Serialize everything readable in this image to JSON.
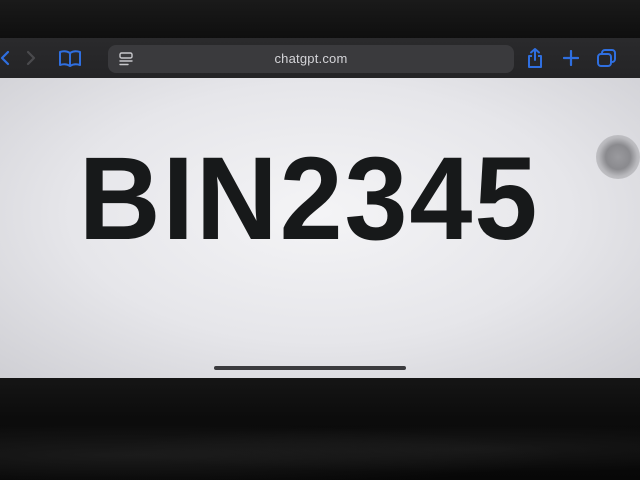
{
  "browser": {
    "url": "chatgpt.com",
    "icons": {
      "back": "chevron-left-icon",
      "forward": "chevron-right-icon",
      "bookmarks": "book-icon",
      "page_menu": "page-menu-icon",
      "reload": "reload-icon",
      "share": "share-icon",
      "new_tab": "plus-icon",
      "tabs": "tabs-icon"
    },
    "accent_color": "#2f6fe0"
  },
  "page": {
    "display_text": "BIN2345"
  }
}
